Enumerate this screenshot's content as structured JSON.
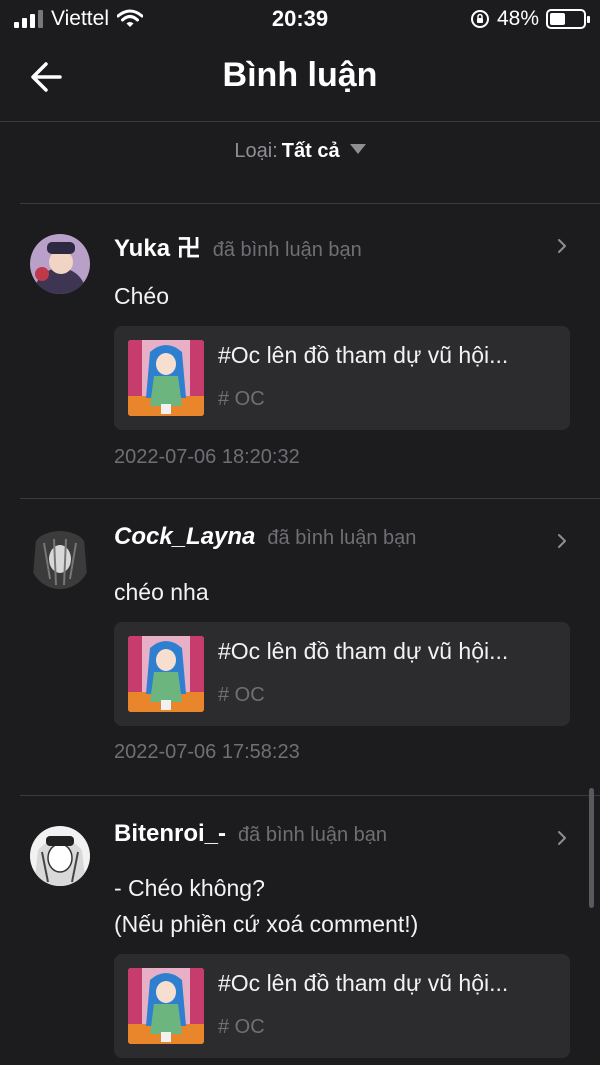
{
  "status_bar": {
    "carrier": "Viettel",
    "time": "20:39",
    "battery": "48%",
    "battery_level": 0.48,
    "icons": [
      "signal-icon",
      "wifi-icon",
      "orientation-lock-icon",
      "battery-icon"
    ]
  },
  "header": {
    "title": "Bình luận",
    "back_icon": "arrow-left-icon"
  },
  "filter": {
    "label": "Loại:",
    "value": "Tất cả"
  },
  "comments": [
    {
      "user": "Yuka 卍",
      "action": "đã bình luận bạn",
      "text": "Chéo",
      "post": {
        "title": "#Oc lên đồ tham dự vũ hội...",
        "tag": "# OC"
      },
      "time": "2022-07-06 18:20:32"
    },
    {
      "user": "Cock_Layna",
      "action": "đã bình luận bạn",
      "text": "chéo nha",
      "post": {
        "title": "#Oc lên đồ tham dự vũ hội...",
        "tag": "# OC"
      },
      "time": "2022-07-06 17:58:23"
    },
    {
      "user": "Bitenroi_-",
      "action": "đã bình luận bạn",
      "text": "- Chéo không?\n(Nếu phiền cứ xoá comment!)",
      "post": {
        "title": "#Oc lên đồ tham dự vũ hội...",
        "tag": "# OC"
      }
    }
  ],
  "colors": {
    "background": "#1c1c1e",
    "card": "#2c2c2e",
    "muted_text": "#6f6f74",
    "divider": "#3a3a3c"
  }
}
